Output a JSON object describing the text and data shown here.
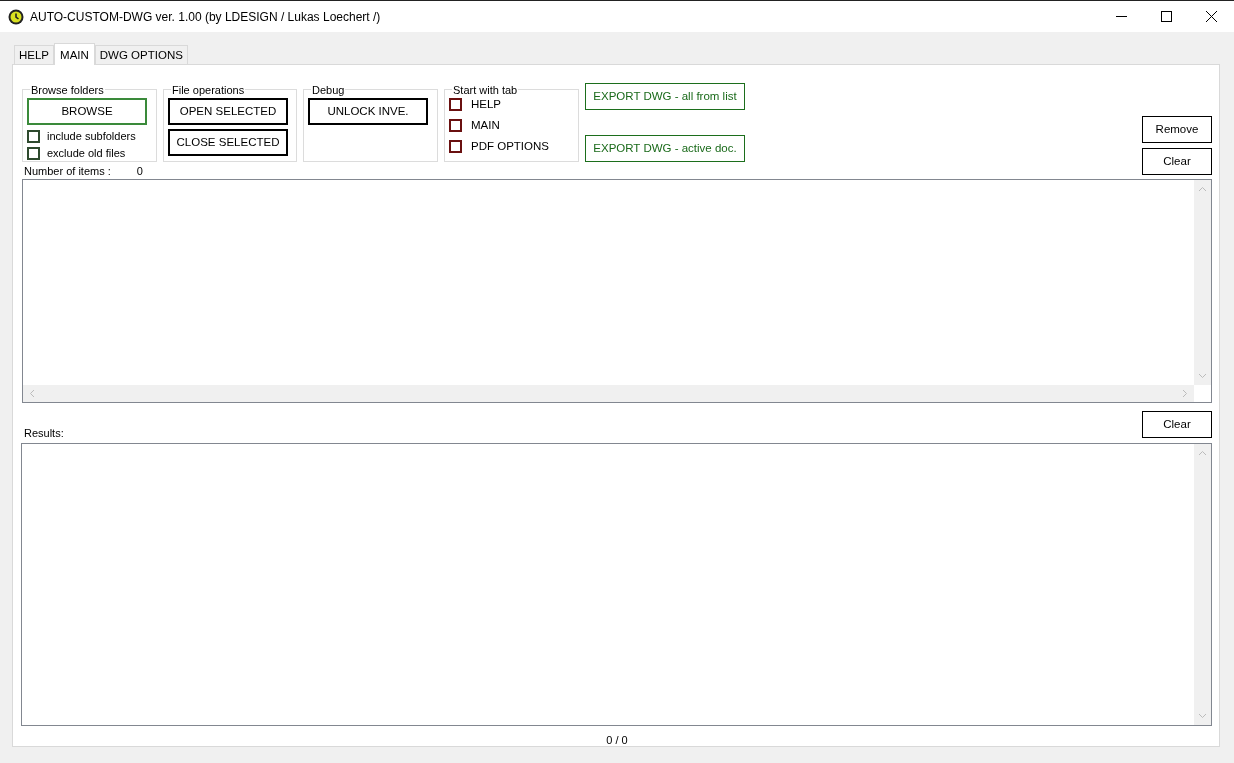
{
  "window": {
    "title": "AUTO-CUSTOM-DWG ver. 1.00 (by LDESIGN / Lukas Loechert /)"
  },
  "tabs": [
    {
      "label": "HELP",
      "selected": false
    },
    {
      "label": "MAIN",
      "selected": true
    },
    {
      "label": "DWG OPTIONS",
      "selected": false
    }
  ],
  "browse_folders": {
    "title": "Browse folders",
    "button": "BROWSE",
    "options": [
      {
        "label": "include subfolders",
        "checked": false
      },
      {
        "label": "exclude old files",
        "checked": false
      }
    ]
  },
  "file_operations": {
    "title": "File operations",
    "buttons": [
      "OPEN SELECTED",
      "CLOSE SELECTED"
    ]
  },
  "debug": {
    "title": "Debug",
    "button": "UNLOCK INVE."
  },
  "start_with_tab": {
    "title": "Start with tab",
    "options": [
      {
        "label": "HELP",
        "checked": false
      },
      {
        "label": "MAIN",
        "checked": false
      },
      {
        "label": "PDF OPTIONS",
        "checked": false
      }
    ]
  },
  "export_buttons": [
    "EXPORT DWG - all from list",
    "EXPORT DWG - active doc."
  ],
  "list_buttons": [
    "Remove",
    "Clear"
  ],
  "number_of_items": {
    "label": "Number of items :",
    "value": "0"
  },
  "results": {
    "label": "Results:",
    "clear_button": "Clear"
  },
  "status": "0 / 0"
}
